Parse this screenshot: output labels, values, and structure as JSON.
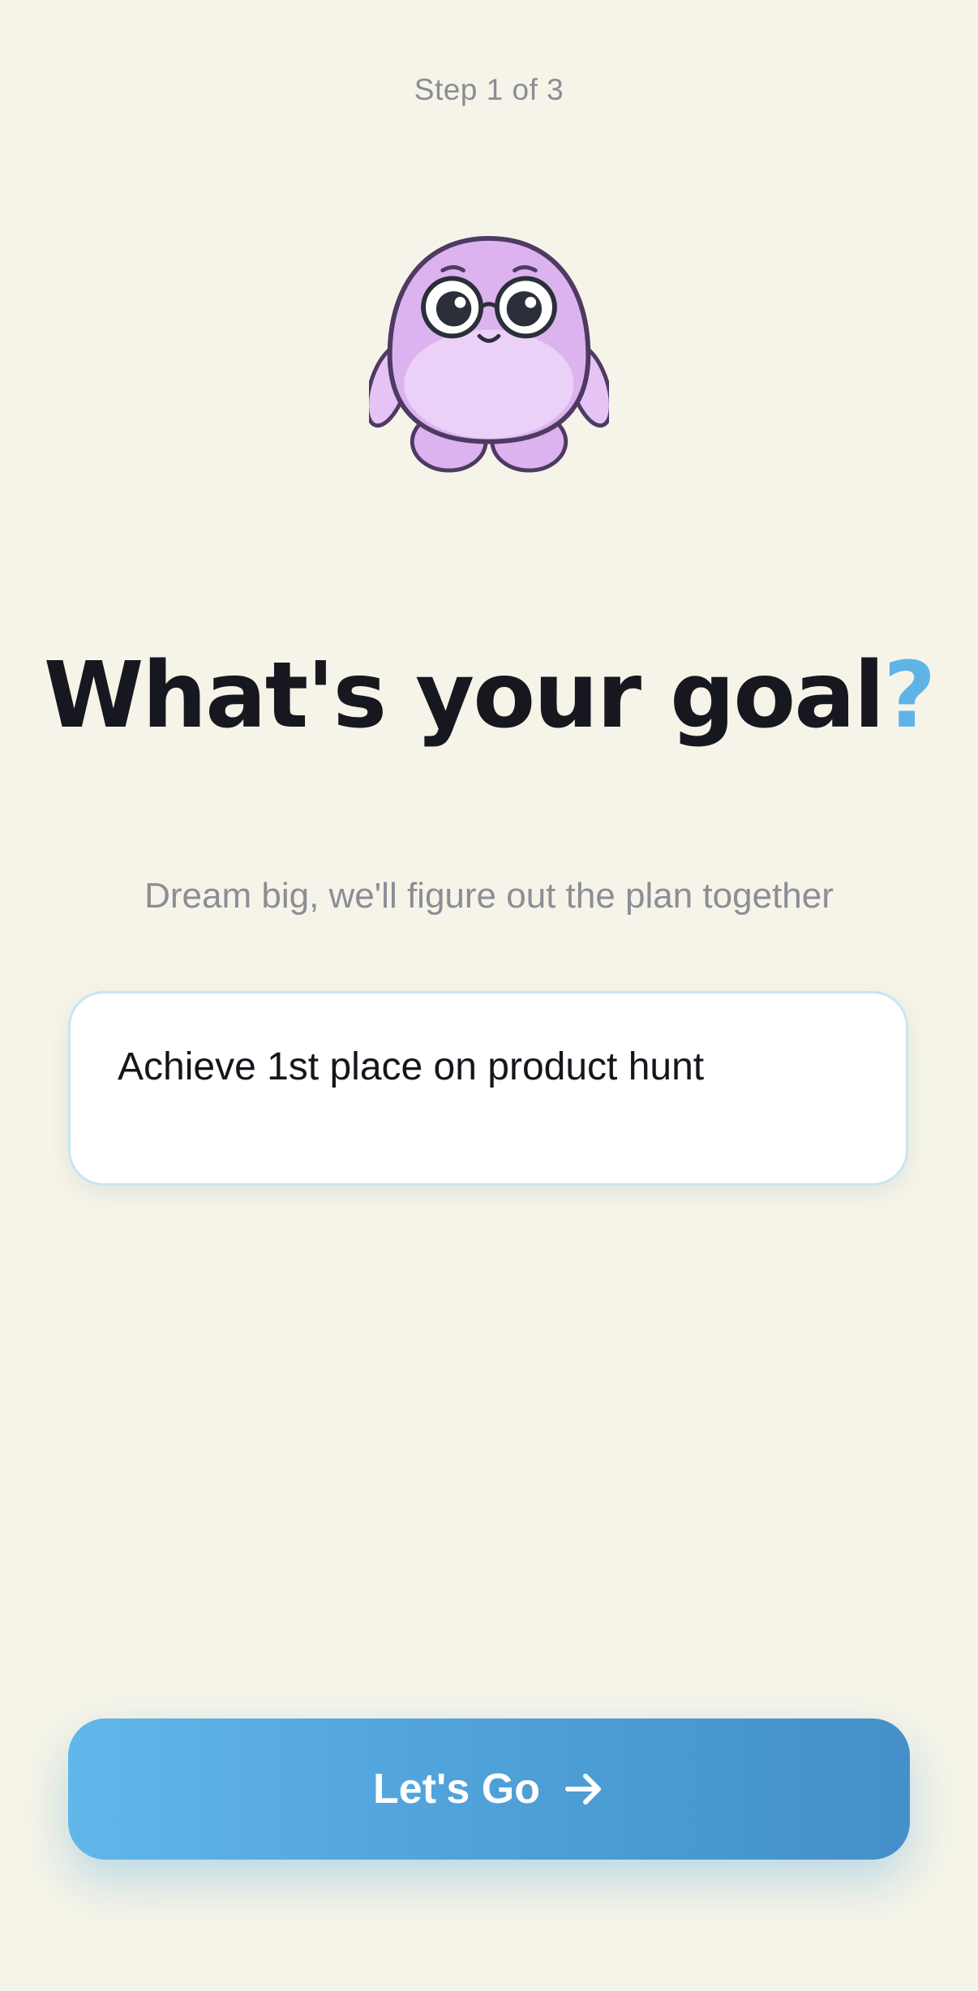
{
  "header": {
    "step_label": "Step 1 of 3"
  },
  "mascot": {
    "icon": "purple-creature-with-glasses-mascot"
  },
  "main": {
    "title_main": "What's your goal",
    "title_mark": "?",
    "subtitle": "Dream big, we'll figure out the plan together",
    "goal_input": {
      "value": "Achieve 1st place on product hunt"
    }
  },
  "footer": {
    "cta_label": "Let's Go",
    "cta_icon": "arrow-right-icon"
  },
  "colors": {
    "background": "#f6f4e8",
    "accent": "#5fb3e6",
    "title": "#17181f",
    "muted": "#8c8d95"
  }
}
